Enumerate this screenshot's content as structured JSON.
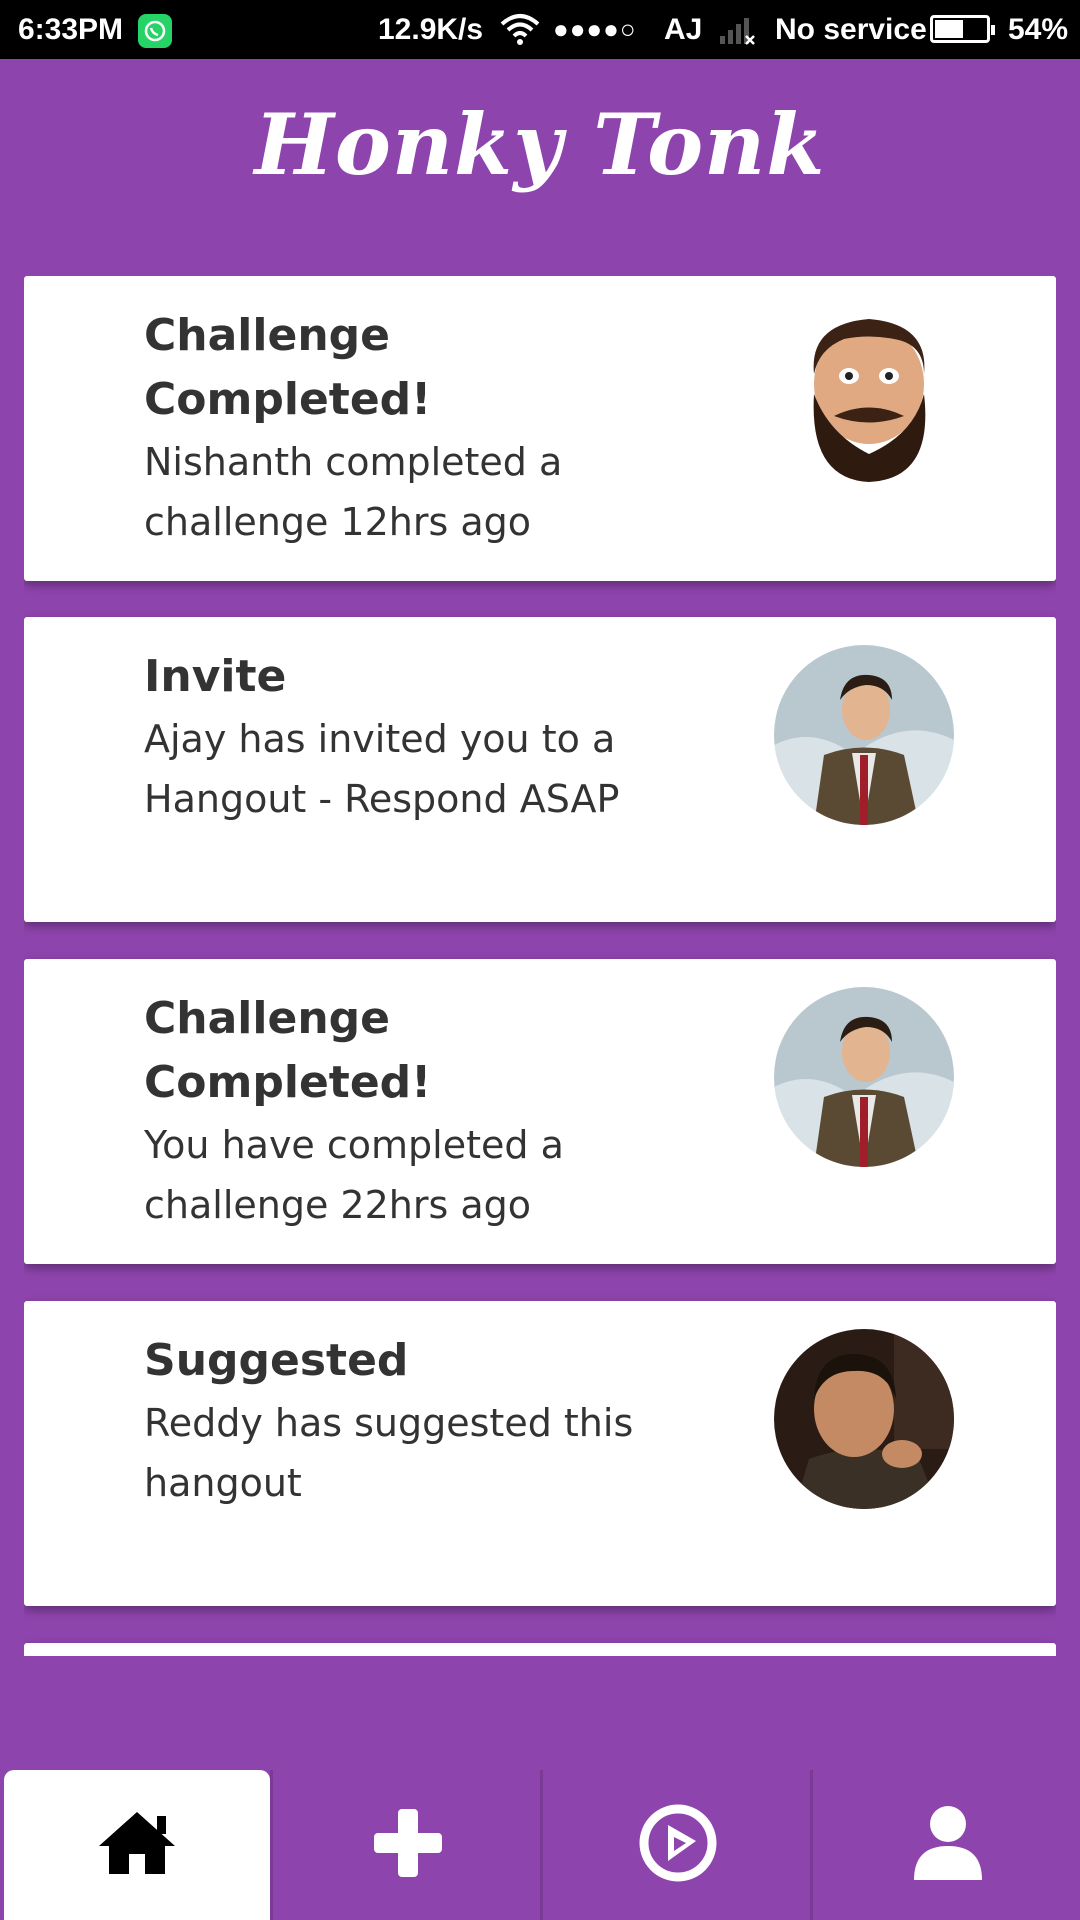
{
  "status_bar": {
    "time": "6:33PM",
    "speed": "12.9K/s",
    "signal_dots": "●●●●○",
    "carrier": "AJ",
    "no_service": "No service",
    "battery_pct": "54%",
    "battery_level": 0.54
  },
  "app": {
    "title": "Honky Tonk",
    "background_color": "#8e44ad"
  },
  "notifications": [
    {
      "title": "Challenge Completed!",
      "description": "Nishanth completed a challenge 12hrs ago",
      "avatar": "bearded-man-avatar"
    },
    {
      "title": "Invite",
      "description": "Ajay has invited you to a Hangout - Respond ASAP",
      "avatar": "man-in-suit-avatar"
    },
    {
      "title": "Challenge Completed!",
      "description": "You have completed a challenge 22hrs ago",
      "avatar": "man-in-suit-avatar"
    },
    {
      "title": "Suggested",
      "description": "Reddy has suggested this hangout",
      "avatar": "man-pointing-avatar"
    }
  ],
  "bottom_nav": {
    "tabs": [
      {
        "icon": "home-icon",
        "active": true
      },
      {
        "icon": "plus-icon",
        "active": false
      },
      {
        "icon": "compass-icon",
        "active": false
      },
      {
        "icon": "user-icon",
        "active": false
      }
    ]
  }
}
